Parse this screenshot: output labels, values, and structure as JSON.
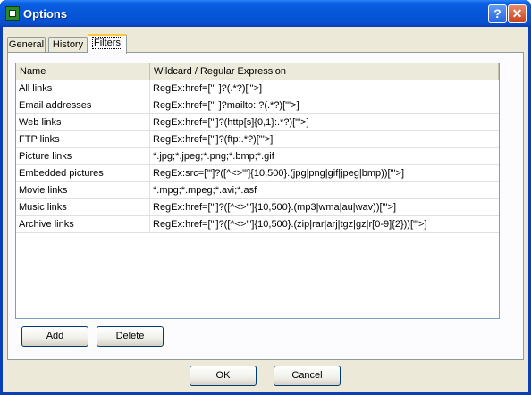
{
  "window": {
    "title": "Options"
  },
  "titlebar": {
    "help_glyph": "?",
    "close_glyph": "✕"
  },
  "tabs": [
    {
      "label": "General"
    },
    {
      "label": "History"
    },
    {
      "label": "Filters",
      "selected": true
    }
  ],
  "filters": {
    "columns": [
      "Name",
      "Wildcard / Regular Expression"
    ],
    "rows": [
      {
        "name": "All links",
        "expr": "RegEx:href=[\"' ]?(.*?)[\"'>]"
      },
      {
        "name": "Email addresses",
        "expr": "RegEx:href=[\"' ]?mailto: ?(.*?)[\"'>]"
      },
      {
        "name": "Web links",
        "expr": "RegEx:href=[\"']?(http[s]{0,1}:.*?)[\"'>]"
      },
      {
        "name": "FTP links",
        "expr": "RegEx:href=[\"']?(ftp:.*?)[\"'>]"
      },
      {
        "name": "Picture links",
        "expr": "*.jpg;*.jpeg;*.png;*.bmp;*.gif"
      },
      {
        "name": "Embedded pictures",
        "expr": "RegEx:src=[\"']?([^<>\"']{10,500}.(jpg|png|gif|jpeg|bmp))[\"'>]"
      },
      {
        "name": "Movie links",
        "expr": "*.mpg;*.mpeg;*.avi;*.asf"
      },
      {
        "name": "Music links",
        "expr": "RegEx:href=[\"']?([^<>\"']{10,500}.(mp3|wma|au|wav))[\"'>]"
      },
      {
        "name": "Archive links",
        "expr": "RegEx:href=[\"']?([^<>\"']{10,500}.(zip|rar|arj|tgz|gz|r[0-9]{2}))[\"'>]"
      }
    ],
    "add_label": "Add",
    "delete_label": "Delete"
  },
  "dialog": {
    "ok_label": "OK",
    "cancel_label": "Cancel"
  }
}
